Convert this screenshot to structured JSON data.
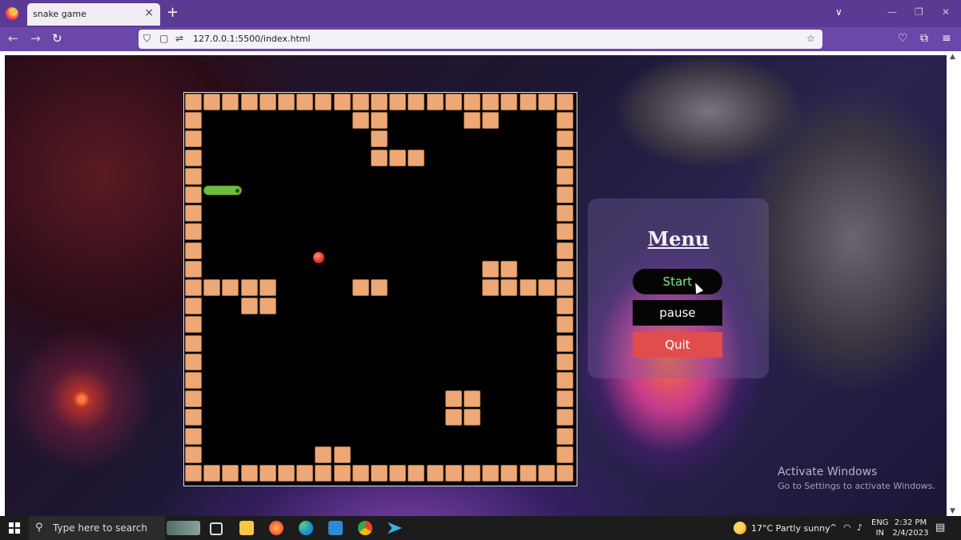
{
  "browser": {
    "tab_title": "snake game",
    "url": "127.0.0.1:5500/index.html",
    "icons": {
      "close": "×",
      "new_tab": "+",
      "back": "←",
      "forward": "→",
      "reload": "↻",
      "tab_list": "∨",
      "minimize": "—",
      "restore": "❐",
      "window_close": "✕",
      "shield": "⛉",
      "page": "▢",
      "site_info": "⇌",
      "bookmark": "☆",
      "pocket": "♡",
      "extensions": "⧉",
      "menu": "≡"
    }
  },
  "game": {
    "grid_cols": 21,
    "grid_rows": 21,
    "board_color": "#000000",
    "wall_color": "#eda875",
    "snake_color": "#6fbd3e",
    "food_color": "#e5321f",
    "obstacles": [
      {
        "col": 9,
        "row": 1
      },
      {
        "col": 10,
        "row": 1
      },
      {
        "col": 15,
        "row": 1
      },
      {
        "col": 16,
        "row": 1
      },
      {
        "col": 10,
        "row": 2
      },
      {
        "col": 10,
        "row": 3
      },
      {
        "col": 11,
        "row": 3
      },
      {
        "col": 12,
        "row": 3
      },
      {
        "col": 16,
        "row": 9
      },
      {
        "col": 17,
        "row": 9
      },
      {
        "col": 1,
        "row": 10
      },
      {
        "col": 2,
        "row": 10
      },
      {
        "col": 3,
        "row": 10
      },
      {
        "col": 4,
        "row": 10
      },
      {
        "col": 9,
        "row": 10
      },
      {
        "col": 10,
        "row": 10
      },
      {
        "col": 16,
        "row": 10
      },
      {
        "col": 17,
        "row": 10
      },
      {
        "col": 18,
        "row": 10
      },
      {
        "col": 19,
        "row": 10
      },
      {
        "col": 3,
        "row": 11
      },
      {
        "col": 4,
        "row": 11
      },
      {
        "col": 14,
        "row": 16
      },
      {
        "col": 15,
        "row": 16
      },
      {
        "col": 14,
        "row": 17
      },
      {
        "col": 15,
        "row": 17
      },
      {
        "col": 7,
        "row": 19
      },
      {
        "col": 8,
        "row": 19
      },
      {
        "col": 7,
        "row": 20
      },
      {
        "col": 8,
        "row": 20
      }
    ]
  },
  "menu": {
    "title": "Menu",
    "start_label": "Start",
    "pause_label": "pause",
    "quit_label": "Quit"
  },
  "watermark": {
    "title": "Activate Windows",
    "subtitle": "Go to Settings to activate Windows."
  },
  "taskbar": {
    "search_placeholder": "Type here to search",
    "search_icon": "⚲",
    "weather": "17°C  Partly sunny",
    "tray_up": "^",
    "tray_wifi": "◠",
    "tray_volume": "♪",
    "lang_line1": "ENG",
    "lang_line2": "IN",
    "time": "2:32 PM",
    "date": "2/4/2023",
    "notification_icon": "▤",
    "scroll_up": "▲",
    "scroll_down": "▼"
  }
}
